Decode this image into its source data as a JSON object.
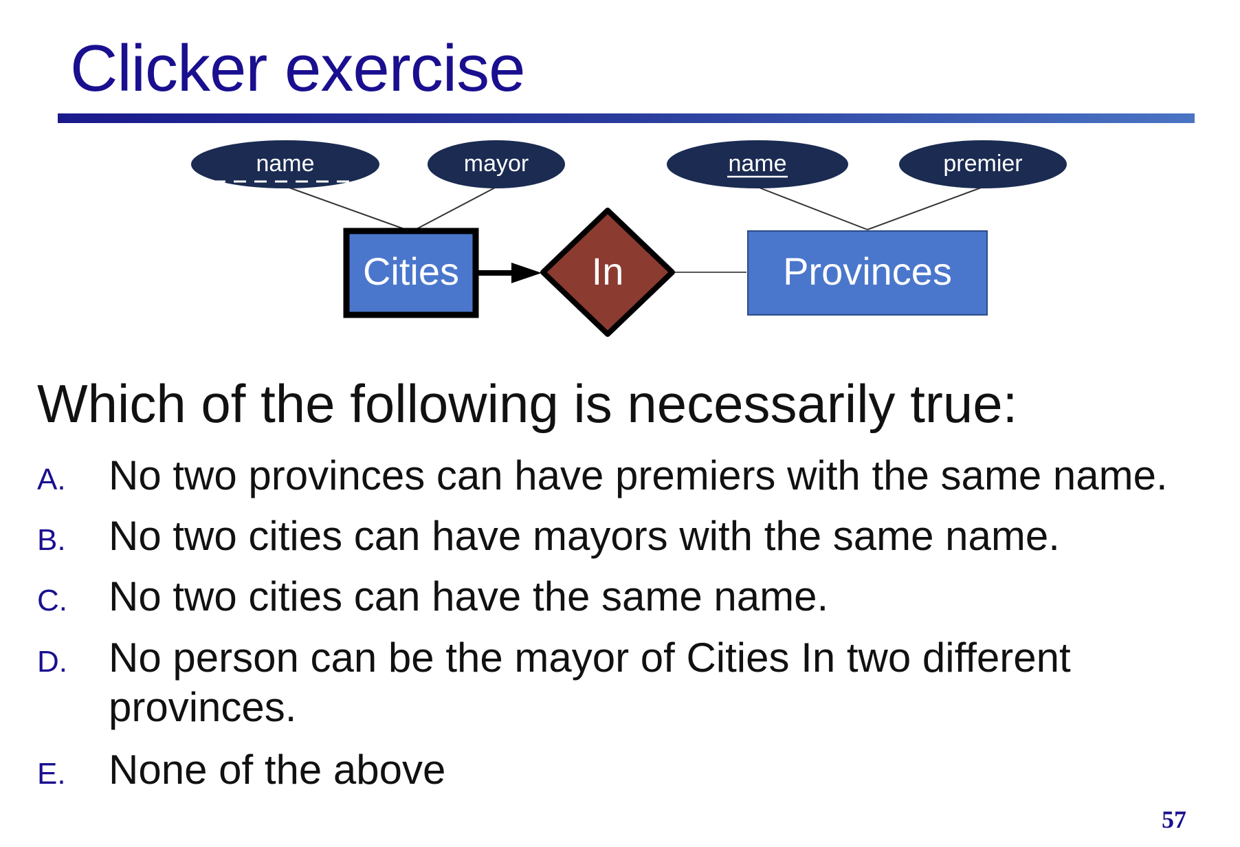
{
  "slide": {
    "title": "Clicker exercise",
    "page_number": "57"
  },
  "diagram": {
    "entities": {
      "cities": "Cities",
      "provinces": "Provinces"
    },
    "relationship": "In",
    "attributes": {
      "city_name": "name",
      "city_mayor": "mayor",
      "province_name": "name",
      "province_premier": "premier"
    },
    "colors": {
      "attribute_fill": "#1b2b52",
      "entity_fill": "#4a77cc",
      "relationship_fill": "#8b3b30"
    }
  },
  "question": "Which of the following is necessarily true:",
  "options": [
    {
      "letter": "A.",
      "text": "No two provinces can have premiers with the same name."
    },
    {
      "letter": "B.",
      "text": "No two cities can have mayors with the same name."
    },
    {
      "letter": "C.",
      "text": "No two cities can have the same name."
    },
    {
      "letter": "D.",
      "text": "No person can be the mayor of Cities In two different provinces."
    },
    {
      "letter": "E.",
      "text": "None of the above"
    }
  ]
}
